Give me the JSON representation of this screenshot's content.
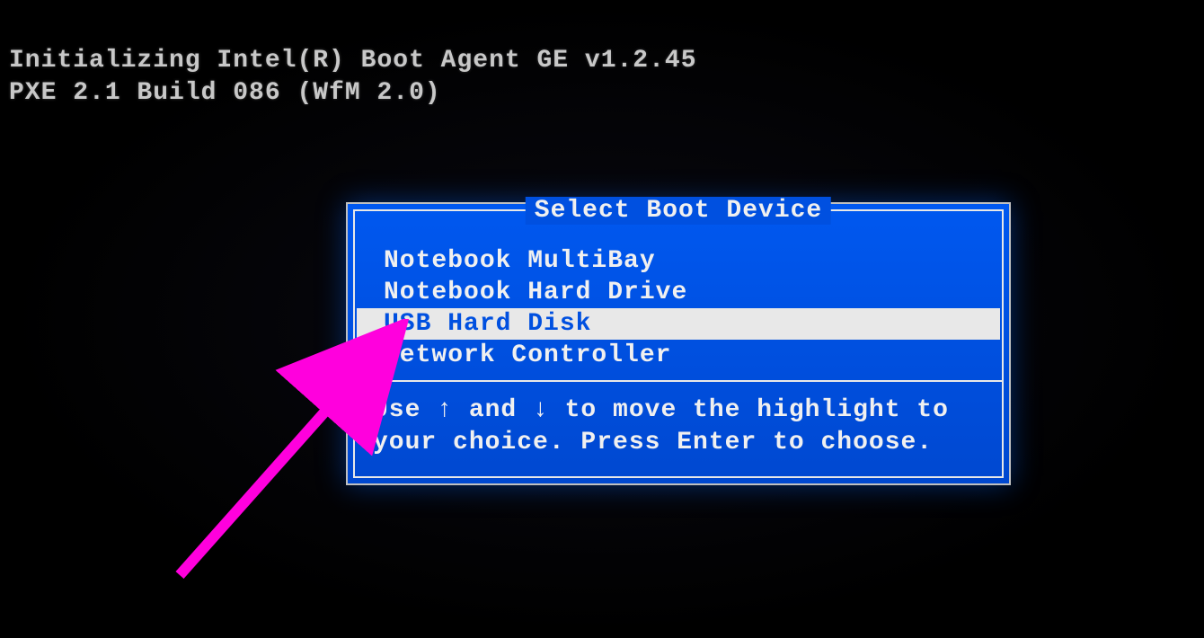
{
  "boot": {
    "line1": "Initializing Intel(R) Boot Agent GE v1.2.45",
    "line2": "PXE 2.1 Build 086 (WfM 2.0)"
  },
  "dialog": {
    "title": "Select Boot Device",
    "items": [
      {
        "label": "Notebook MultiBay",
        "selected": false
      },
      {
        "label": "Notebook Hard Drive",
        "selected": false
      },
      {
        "label": "USB Hard Disk",
        "selected": true
      },
      {
        "label": "Network Controller",
        "selected": false
      }
    ],
    "help_line1": "Use ↑ and ↓ to move the highlight to",
    "help_line2": "your choice.  Press Enter to choose."
  }
}
